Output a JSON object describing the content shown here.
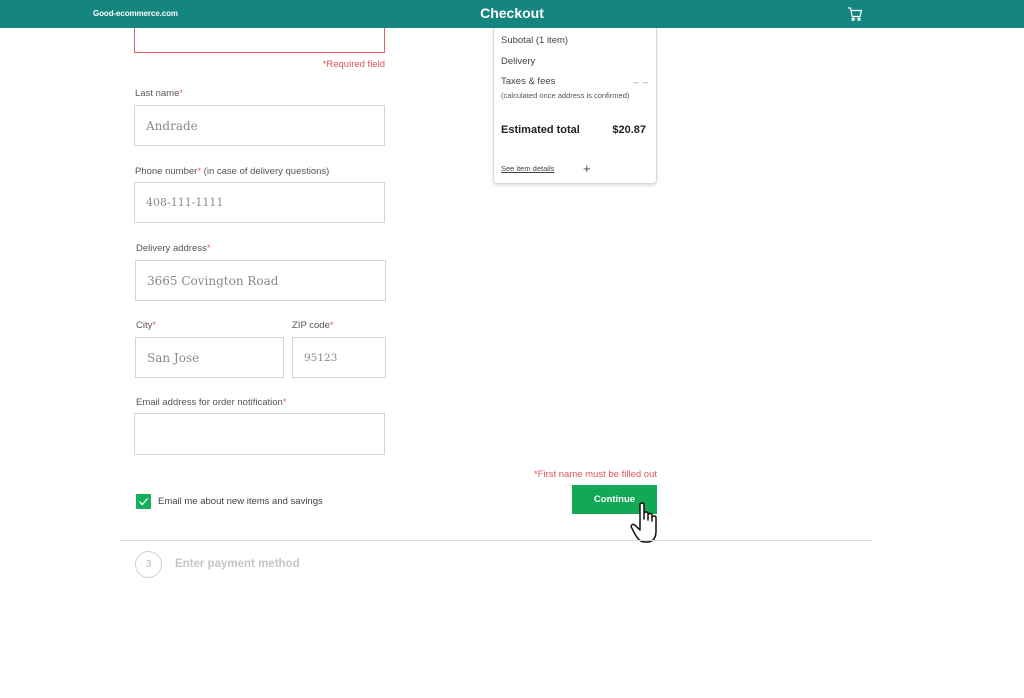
{
  "header": {
    "brand": "Good-ecommerce.com",
    "title": "Checkout",
    "cart_icon": "cart-icon",
    "background_color": "#14867f"
  },
  "form": {
    "first_name": {
      "value": "",
      "error": "*Required field"
    },
    "last_name": {
      "label": "Last name",
      "required_mark": "*",
      "value": "Andrade"
    },
    "phone": {
      "label": "Phone number",
      "required_mark": "*",
      "hint": " (in case of delivery questions)",
      "value": "408-111-1111"
    },
    "address": {
      "label": "Delivery address",
      "required_mark": "*",
      "value": "3665 Covington Road"
    },
    "city": {
      "label": "City",
      "required_mark": "*",
      "value": "San Jose"
    },
    "zip": {
      "label": "ZIP code",
      "required_mark": "*",
      "value": "95123"
    },
    "email": {
      "label": "Email address for order notification",
      "required_mark": "*",
      "value": ""
    },
    "newsletter": {
      "label": "Email me about new items and savings",
      "checked": true
    },
    "submit_error": "*First name must be filled out",
    "continue_label": "Continue"
  },
  "summary": {
    "subtotal_label": "Subotal (1 item)",
    "delivery_label": "Delivery",
    "taxes_label": "Taxes & fees",
    "taxes_note": "(calculated once address is confirmed)",
    "taxes_value": "– –",
    "total_label": "Estimated total",
    "total_value": "$20.87",
    "details_link": "See item details",
    "expand_symbol": "+"
  },
  "steps": {
    "payment": {
      "number": "3",
      "title": "Enter payment method"
    }
  },
  "colors": {
    "accent_green": "#12a855",
    "error_red": "#e05555"
  }
}
